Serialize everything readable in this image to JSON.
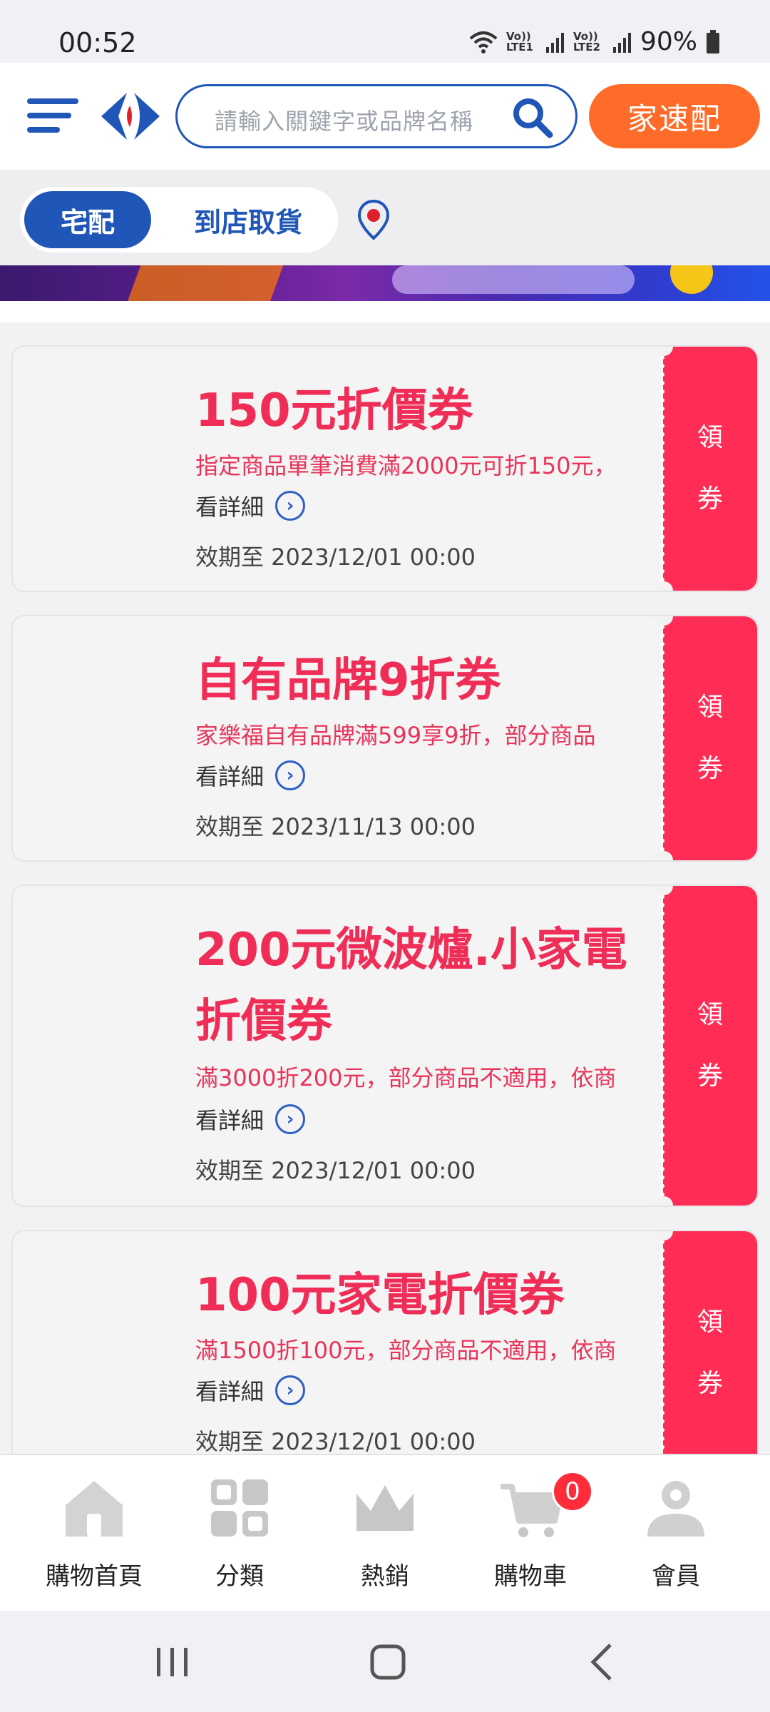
{
  "status_bar": {
    "time": "00:52",
    "sim1_label": "Vo)) LTE1",
    "sim2_label": "Vo)) LTE2",
    "battery": "90%"
  },
  "header": {
    "search_placeholder": "請輸入關鍵字或品牌名稱",
    "home_delivery_label": "家速配",
    "brand_color": "#1f56b7",
    "accent_color": "#ff6b28"
  },
  "delivery_mode": {
    "options": [
      "宅配",
      "到店取貨"
    ],
    "selected": "宅配"
  },
  "coupons": [
    {
      "title": "150元折價券",
      "description": "指定商品單筆消費滿2000元可折150元，",
      "detail_label": "看詳細",
      "expiry": "效期至 2023/12/01 00:00",
      "claim_label_line1": "領",
      "claim_label_line2": "券"
    },
    {
      "title": "自有品牌9折券",
      "description": "家樂福自有品牌滿599享9折，部分商品",
      "detail_label": "看詳細",
      "expiry": "效期至 2023/11/13 00:00",
      "claim_label_line1": "領",
      "claim_label_line2": "券"
    },
    {
      "title_line1": "200元微波爐.小家電",
      "title_line2": "折價券",
      "description": "滿3000折200元，部分商品不適用，依商",
      "detail_label": "看詳細",
      "expiry": "效期至 2023/12/01 00:00",
      "claim_label_line1": "領",
      "claim_label_line2": "券"
    },
    {
      "title": "100元家電折價券",
      "description": "滿1500折100元，部分商品不適用，依商",
      "detail_label": "看詳細",
      "expiry": "效期至 2023/12/01 00:00",
      "claim_label_line1": "領",
      "claim_label_line2": "券"
    }
  ],
  "bottom_nav": {
    "items": [
      {
        "label": "購物首頁",
        "icon": "home-icon"
      },
      {
        "label": "分類",
        "icon": "category-icon"
      },
      {
        "label": "熱銷",
        "icon": "crown-icon"
      },
      {
        "label": "購物車",
        "icon": "cart-icon"
      },
      {
        "label": "會員",
        "icon": "member-icon"
      }
    ],
    "cart_count": "0"
  },
  "colors": {
    "coupon_red": "#ff2d55",
    "title_red": "#ef2d56"
  }
}
